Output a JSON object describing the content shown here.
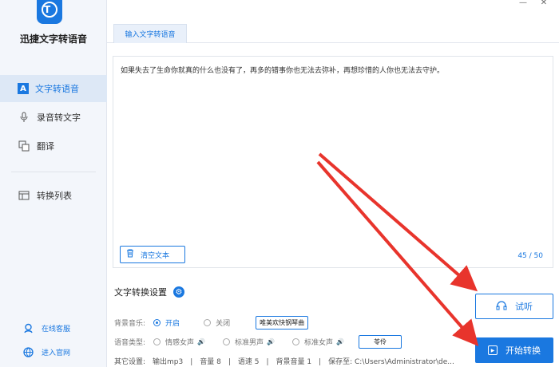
{
  "app": {
    "title": "迅捷文字转语音",
    "logo_letter": "T"
  },
  "sidebar": {
    "items": [
      {
        "label": "文字转语音",
        "icon": "text-to-speech-icon",
        "active": true
      },
      {
        "label": "录音转文字",
        "icon": "microphone-icon",
        "active": false
      },
      {
        "label": "翻译",
        "icon": "translate-icon",
        "active": false
      },
      {
        "label": "转换列表",
        "icon": "list-icon",
        "active": false
      }
    ],
    "footer": [
      {
        "label": "在线客服",
        "icon": "customer-service-icon"
      },
      {
        "label": "进入官网",
        "icon": "globe-icon"
      }
    ]
  },
  "tabs": [
    {
      "label": "输入文字转语音",
      "active": true
    }
  ],
  "editor": {
    "text": "如果失去了生命你就真的什么也没有了，再多的错事你也无法去弥补，再想珍惜的人你也无法去守护。",
    "counter": "45 / 50",
    "clear_label": "清空文本"
  },
  "settings": {
    "title": "文字转换设置",
    "bg_music_label": "背景音乐:",
    "bg_on": "开启",
    "bg_off": "关闭",
    "bg_music_selected": "开启",
    "bg_track": "唯美欢快钢琴曲",
    "voice_label": "语音类型:",
    "voices": [
      "情感女声",
      "标准男声",
      "标准女声"
    ],
    "voice_more": "苓伶",
    "other_text": "其它设置:　输出mp3　|　音量 8　|　语速 5　|　背景音量 1　|　保存至: C:\\Users\\Administrator\\de..."
  },
  "actions": {
    "try_label": "试听",
    "start_label": "开始转换"
  },
  "colors": {
    "accent": "#1a78e0",
    "arrow": "#e8342c"
  }
}
